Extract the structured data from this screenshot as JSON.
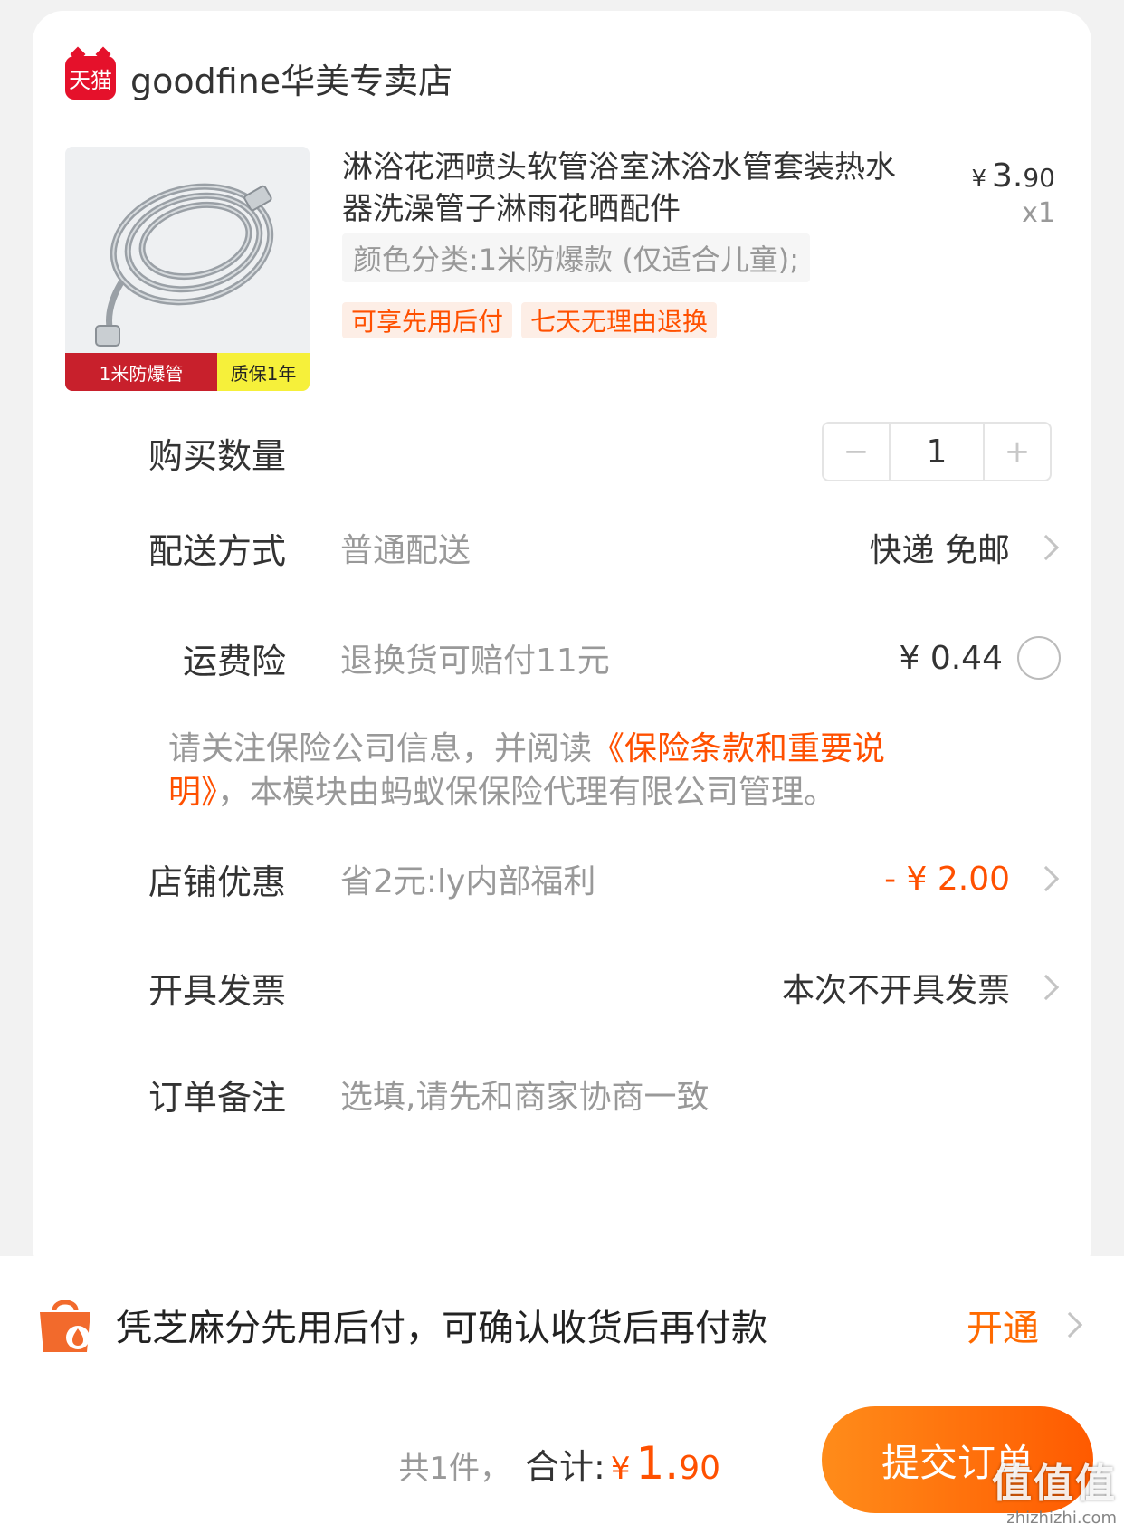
{
  "shop": {
    "logo_text": "天猫",
    "name": "goodfine华美专卖店"
  },
  "product": {
    "image_tags": {
      "left": "1米防爆管",
      "right": "质保1年"
    },
    "title": "淋浴花洒喷头软管浴室沐浴水管套装热水器洗澡管子淋雨花晒配件",
    "price": {
      "currency": "¥",
      "integer": "3.",
      "decimals": "90"
    },
    "quantity": "x1",
    "sku": "颜色分类:1米防爆款 (仅适合儿童);",
    "badges": [
      "可享先用后付",
      "七天无理由退换"
    ]
  },
  "rows": {
    "quantity": {
      "label": "购买数量",
      "minus": "−",
      "value": "1",
      "plus": "+"
    },
    "delivery": {
      "label": "配送方式",
      "sub": "普通配送",
      "value": "快递 免邮"
    },
    "insurance": {
      "label": "运费险",
      "sub": "退换货可赔付11元",
      "value": "¥ 0.44"
    },
    "discount": {
      "label": "店铺优惠",
      "sub": "省2元:ly内部福利",
      "value": "- ¥ 2.00"
    },
    "invoice": {
      "label": "开具发票",
      "value": "本次不开具发票"
    },
    "note": {
      "label": "订单备注",
      "placeholder": "选填,请先和商家协商一致"
    }
  },
  "notice": {
    "prefix": "请关注保险公司信息，并阅读",
    "link": "《保险条款和重要说明》",
    "suffix": "，本模块由蚂蚁保保险代理有限公司管理。"
  },
  "zhima": {
    "text": "凭芝麻分先用后付，可确认收货后再付款",
    "action": "开通"
  },
  "footer": {
    "count": "共1件，",
    "total_label": "合计:",
    "currency": "¥",
    "total_int": "1.",
    "total_dec": "90",
    "submit": "提交订单"
  },
  "watermark": {
    "big": "值值值",
    "small": "zhizhizhi.com"
  },
  "colors": {
    "accent": "#ff5000",
    "submit_start": "#ff8c1a",
    "submit_end": "#ff5a00",
    "tmall_red": "#e5112b"
  }
}
